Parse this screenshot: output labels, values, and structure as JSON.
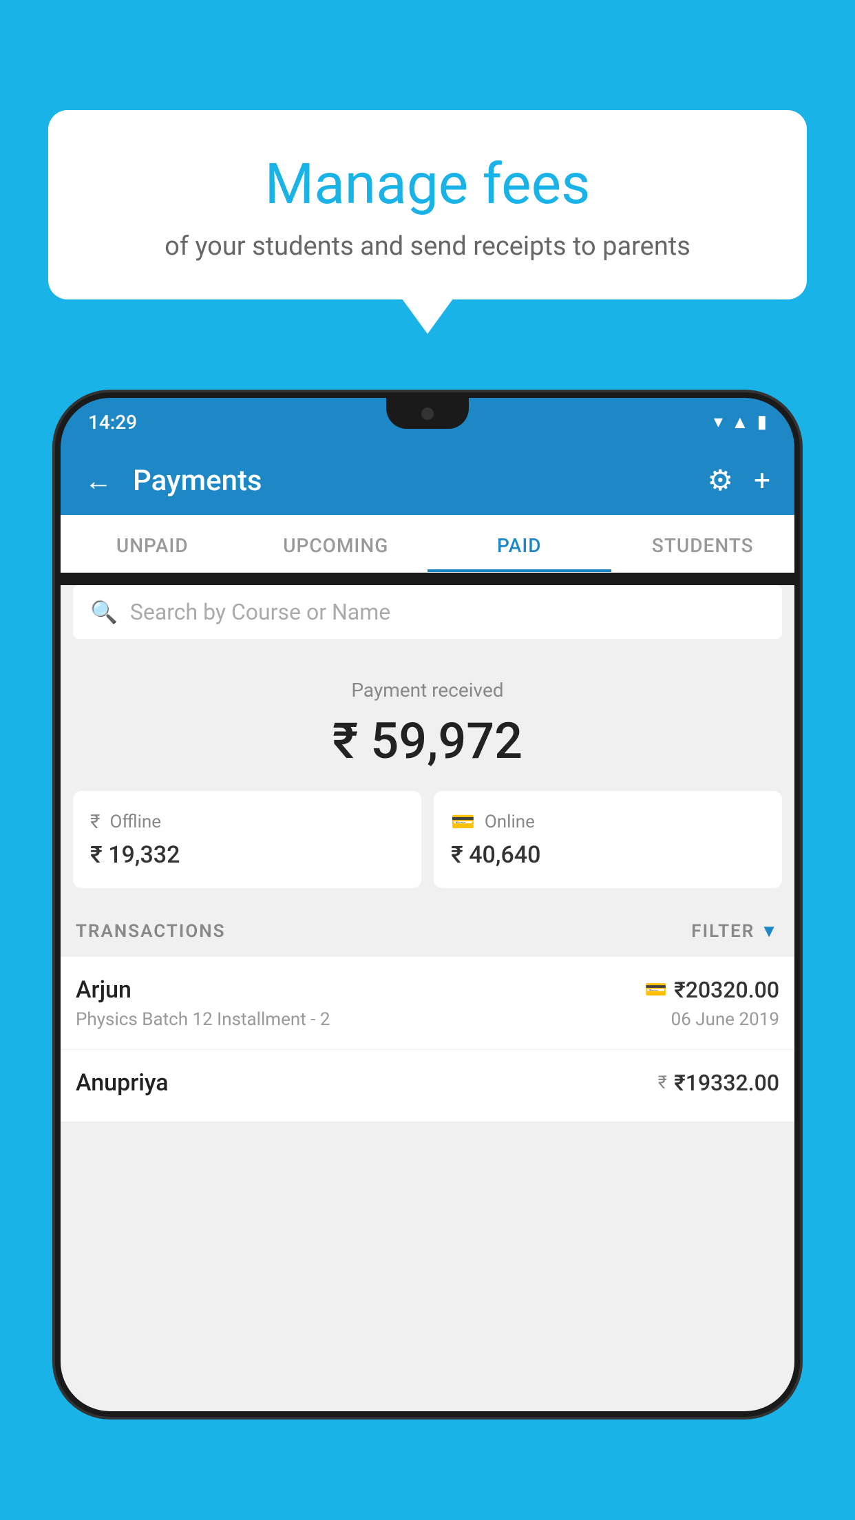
{
  "page": {
    "background_color": "#1ab3e8"
  },
  "bubble": {
    "title": "Manage fees",
    "subtitle": "of your students and send receipts to parents"
  },
  "status_bar": {
    "time": "14:29"
  },
  "header": {
    "title": "Payments",
    "back_label": "←",
    "plus_label": "+"
  },
  "tabs": [
    {
      "label": "UNPAID",
      "active": false
    },
    {
      "label": "UPCOMING",
      "active": false
    },
    {
      "label": "PAID",
      "active": true
    },
    {
      "label": "STUDENTS",
      "active": false
    }
  ],
  "search": {
    "placeholder": "Search by Course or Name"
  },
  "payment_summary": {
    "label": "Payment received",
    "amount": "₹ 59,972"
  },
  "payment_cards": [
    {
      "type": "Offline",
      "amount": "₹ 19,332"
    },
    {
      "type": "Online",
      "amount": "₹ 40,640"
    }
  ],
  "transactions": {
    "section_label": "TRANSACTIONS",
    "filter_label": "FILTER",
    "rows": [
      {
        "name": "Arjun",
        "course": "Physics Batch 12 Installment - 2",
        "amount": "₹20320.00",
        "date": "06 June 2019",
        "icon_type": "card"
      },
      {
        "name": "Anupriya",
        "course": "",
        "amount": "₹19332.00",
        "date": "",
        "icon_type": "cash"
      }
    ]
  }
}
